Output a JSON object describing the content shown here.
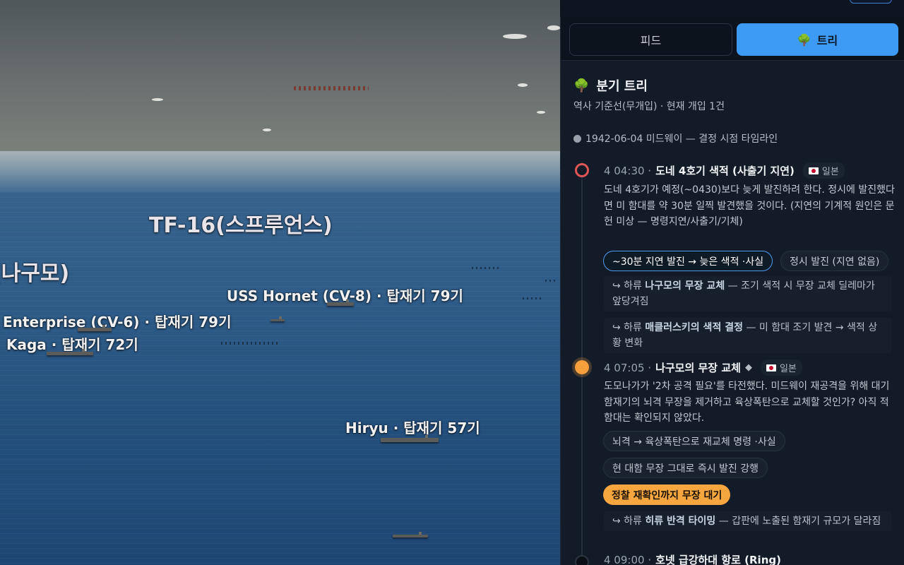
{
  "scene": {
    "labels": {
      "tf16": "TF-16(스프루언스)",
      "nagumo": "(나구모)",
      "hornet": "USS Hornet (CV-8) · 탑재기 79기",
      "enterprise": "Enterprise (CV-6) · 탑재기 79기",
      "kaga": "Kaga · 탑재기 72기",
      "hiryu": "Hiryu · 탑재기 57기"
    }
  },
  "tabs": {
    "feed": "피드",
    "tree": "트리"
  },
  "tree": {
    "title": "분기 트리",
    "subtitle": "역사 기준선(무개입) · 현재 개입 1건",
    "baseline": "1942-06-04 미드웨이 — 결정 시점 타임라인"
  },
  "events": [
    {
      "time": "4 04:30 ·",
      "title": "도네 4호기 색적 (사출기 지연)",
      "faction": "일본",
      "body": "도네 4호기가 예정(~0430)보다 늦게 발진하려 한다. 정시에 발진했다면 미 함대를 약 30분 일찍 발견했을 것이다. (지연의 기계적 원인은 문헌 미상 — 명령지연/사출기/기체)",
      "options": [
        "~30분 지연 발진 → 늦은 색적 ·사실",
        "정시 발진 (지연 없음)"
      ],
      "branches": [
        {
          "prefix": "↪ 하류",
          "target": "나구모의 무장 교체",
          "text": "— 조기 색적 시 무장 교체 딜레마가 앞당겨짐"
        },
        {
          "prefix": "↪ 하류",
          "target": "매클러스키의 색적 결정",
          "text": "— 미 함대 조기 발견 → 색적 상황 변화"
        }
      ]
    },
    {
      "time": "4 07:05 ·",
      "title": "나구모의 무장 교체",
      "marker": "◆",
      "faction": "일본",
      "body": "도모나가가 '2차 공격 필요'를 타전했다. 미드웨이 재공격을 위해 대기 함재기의 뇌격 무장을 제거하고 육상폭탄으로 교체할 것인가? 아직 적 함대는 확인되지 않았다.",
      "options": [
        "뇌격 → 육상폭탄으로 재교체 명령 ·사실",
        "현 대함 무장 그대로 즉시 발진 강행",
        "정찰 재확인까지 무장 대기"
      ],
      "branches": [
        {
          "prefix": "↪ 하류",
          "target": "히류 반격 타이밍",
          "text": "— 갑판에 노출된 함재기 규모가 달라짐"
        }
      ]
    },
    {
      "time": "4 09:00 ·",
      "title": "호넷 급강하대 항로 (Ring)"
    }
  ],
  "colors": {
    "accent": "#3d9bf5",
    "active_option": "#f5a63f",
    "node_current": "#e05555",
    "node_pending": "#f5a03a"
  }
}
